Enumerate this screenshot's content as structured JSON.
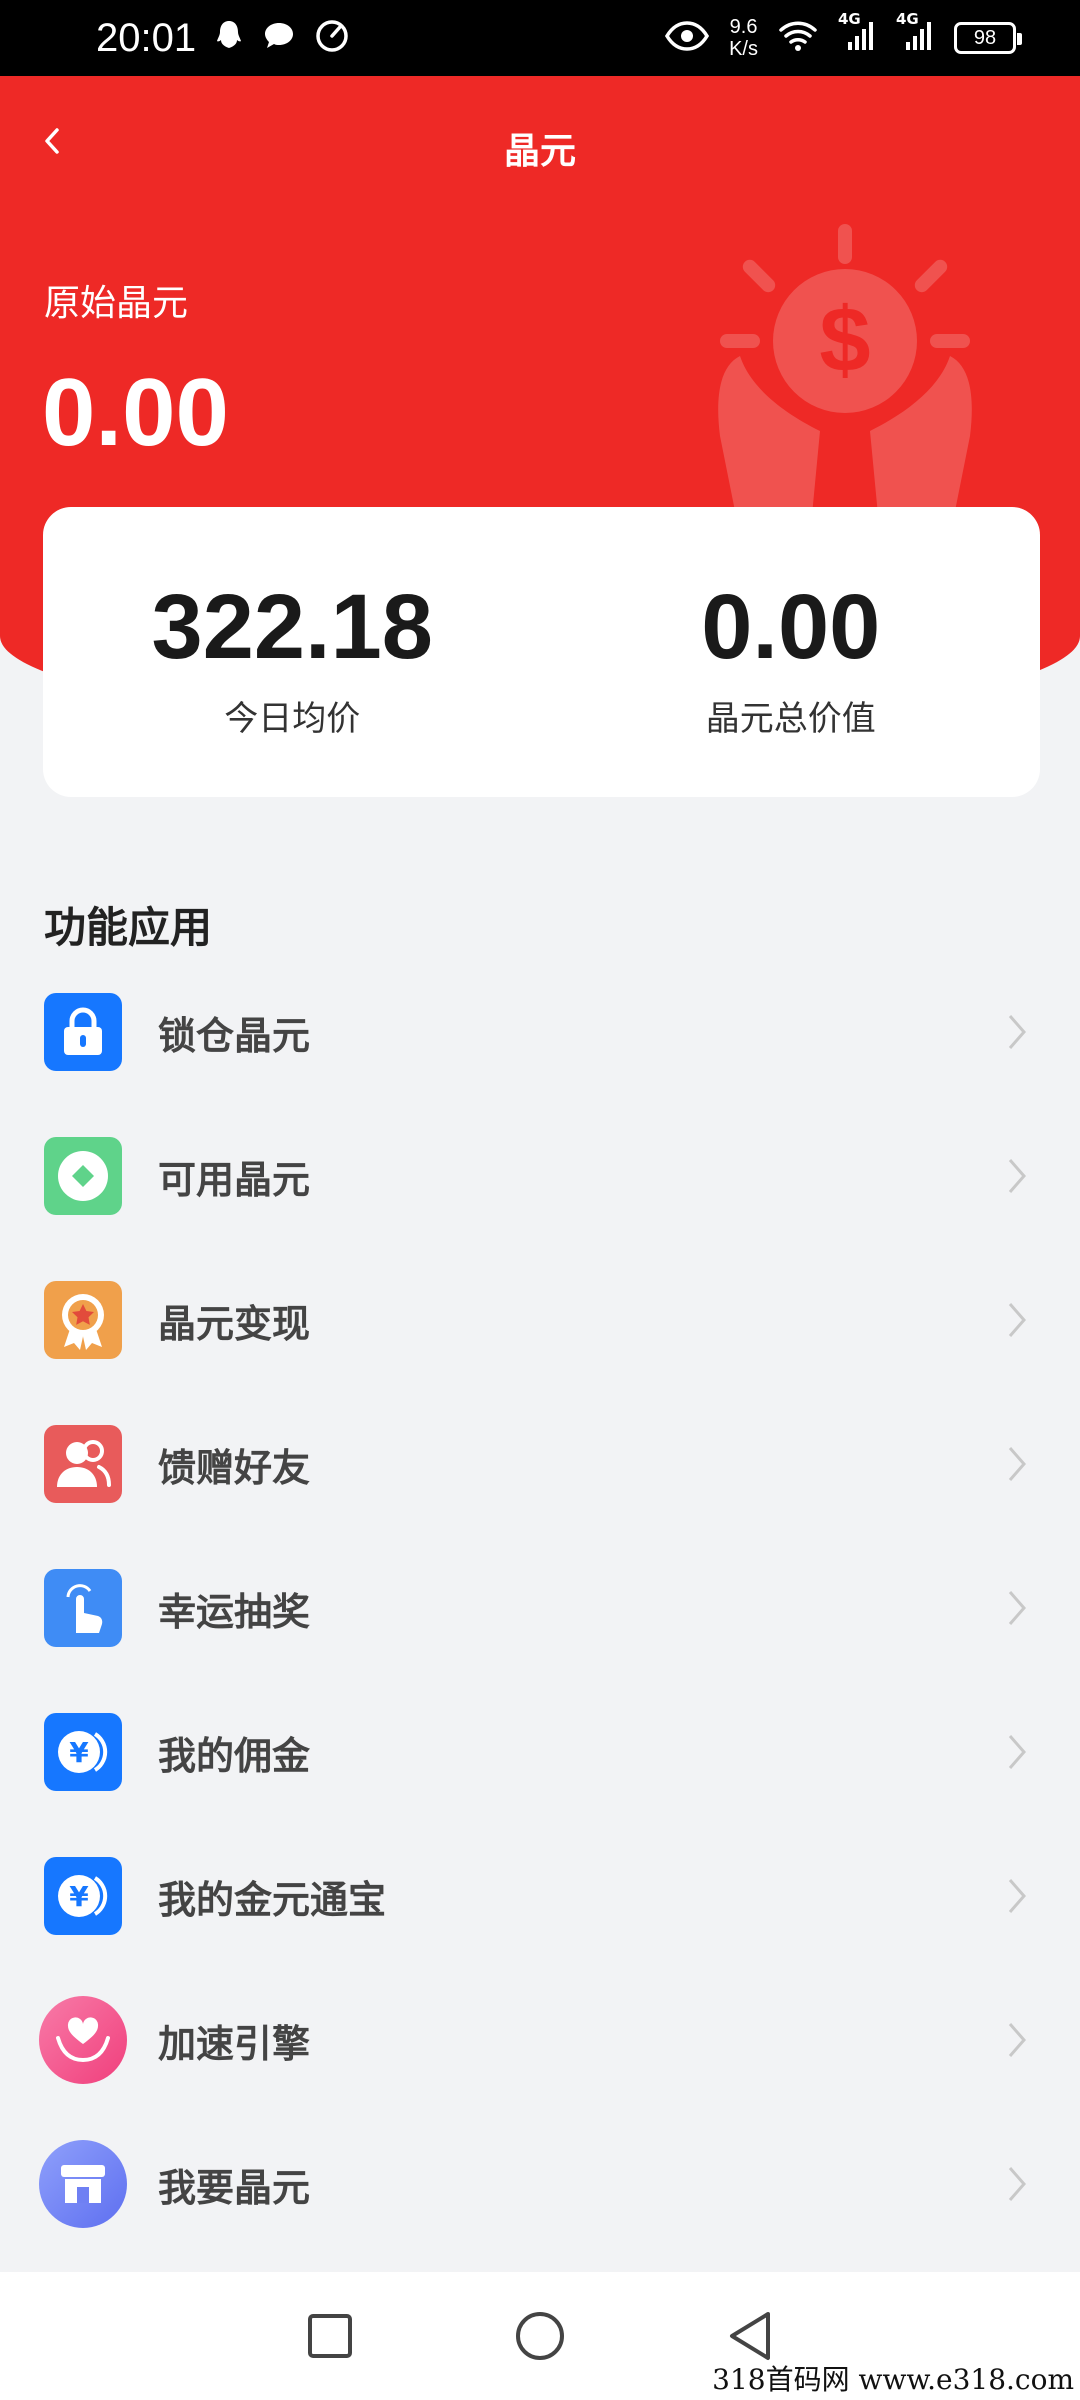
{
  "status_bar": {
    "time": "20:01",
    "net_speed_value": "9.6",
    "net_speed_unit": "K/s",
    "signal_1_label": "4G",
    "signal_2_label": "4G",
    "battery": "98",
    "icons": [
      "qq-icon",
      "message-icon",
      "speed-icon",
      "eye-icon",
      "wifi-icon",
      "signal-icon",
      "battery-icon"
    ]
  },
  "header": {
    "title": "晶元",
    "back_icon": "chevron-left-icon"
  },
  "hero": {
    "label": "原始晶元",
    "value": "0.00"
  },
  "stats": [
    {
      "value": "322.18",
      "label": "今日均价"
    },
    {
      "value": "0.00",
      "label": "晶元总价值"
    }
  ],
  "section": {
    "title": "功能应用"
  },
  "menu": [
    {
      "label": "锁仓晶元",
      "icon": "lock-icon",
      "color": "#1677ff"
    },
    {
      "label": "可用晶元",
      "icon": "coin-icon",
      "color": "#5fd38a"
    },
    {
      "label": "晶元变现",
      "icon": "medal-icon",
      "color": "#f0a04b"
    },
    {
      "label": "馈赠好友",
      "icon": "users-icon",
      "color": "#e85b5b"
    },
    {
      "label": "幸运抽奖",
      "icon": "tap-icon",
      "color": "#3f8cf5"
    },
    {
      "label": "我的佣金",
      "icon": "yen-icon",
      "color": "#1677ff"
    },
    {
      "label": "我的金元通宝",
      "icon": "yen-icon",
      "color": "#1677ff"
    },
    {
      "label": "加速引擎",
      "icon": "heart-hands-icon",
      "color": "#f5508e"
    },
    {
      "label": "我要晶元",
      "icon": "store-icon",
      "color": "#6a7ff5"
    }
  ],
  "colors": {
    "primary_red": "#ee2926",
    "background": "#f2f3f5"
  },
  "watermark": "318首码网 www.e318.com"
}
